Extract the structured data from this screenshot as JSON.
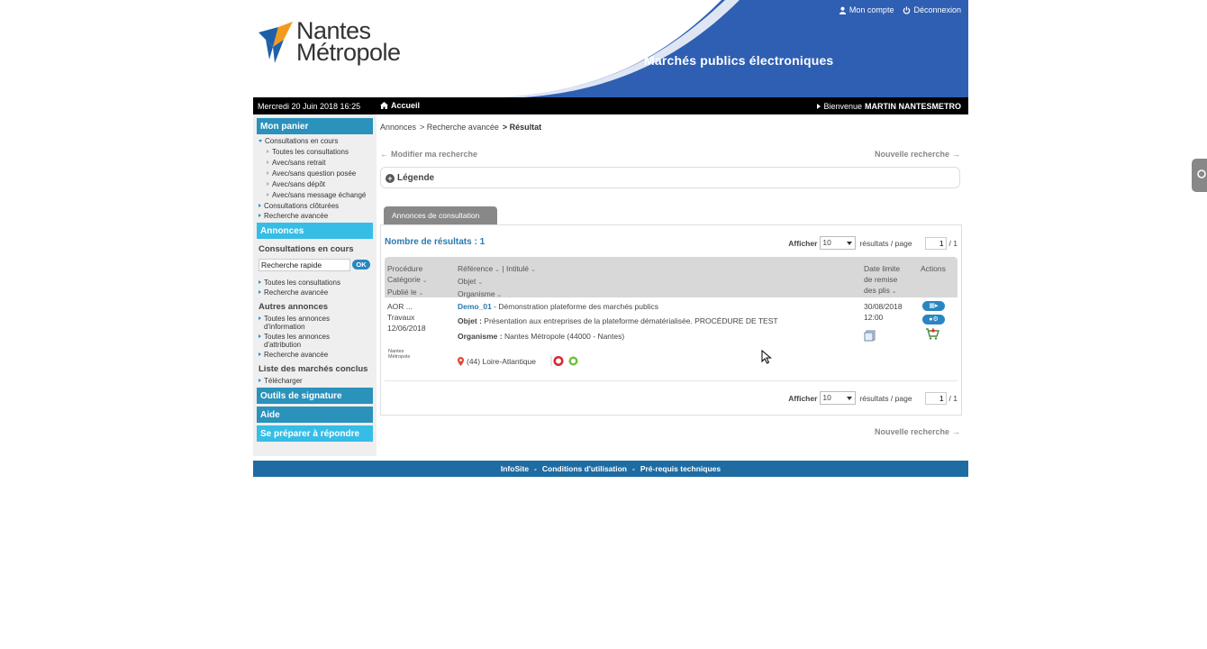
{
  "header": {
    "logo_line1": "Nantes",
    "logo_line2": "Métropole",
    "site_title": "Marchés publics électroniques",
    "account_link": "Mon compte",
    "logout_link": "Déconnexion",
    "colors": {
      "brand_blue": "#2f5fb3",
      "accent_blue": "#2a92bb",
      "light_blue": "#36bde6"
    }
  },
  "topbar": {
    "date": "Mercredi 20 Juin 2018 16:25",
    "home_label": "Accueil",
    "welcome_prefix": "Bienvenue",
    "welcome_user": "MARTIN NANTESMETRO"
  },
  "sidebar": {
    "panier_title": "Mon panier",
    "consultations_en_cours": "Consultations en cours",
    "panier_items": [
      "Toutes les consultations",
      "Avec/sans retrait",
      "Avec/sans question posée",
      "Avec/sans dépôt",
      "Avec/sans message échangé"
    ],
    "consultations_cloturees": "Consultations clôturées",
    "recherche_avancee": "Recherche avancée",
    "annonces_title": "Annonces",
    "annonces_section": "Consultations en cours",
    "quick_search_value": "Recherche rapide",
    "ok_label": "OK",
    "annonces_items": [
      "Toutes les consultations",
      "Recherche avancée"
    ],
    "autres_annonces": "Autres annonces",
    "autres_items": [
      "Toutes les annonces d'information",
      "Toutes les annonces d'attribution",
      "Recherche avancée"
    ],
    "marches_conclus": "Liste des marchés conclus",
    "telecharger": "Télécharger",
    "outils_signature": "Outils de signature",
    "aide": "Aide",
    "se_preparer": "Se préparer à répondre"
  },
  "main": {
    "breadcrumb": [
      "Annonces",
      "> Recherche avancée",
      "> Résultat"
    ],
    "modify_search": "Modifier ma recherche",
    "new_search": "Nouvelle recherche",
    "legend": "Légende",
    "tab_label": "Annonces de consultation",
    "results_count": "Nombre de résultats : 1",
    "pager": {
      "show_label": "Afficher",
      "per_page_value": "10",
      "per_page_suffix": "résultats / page",
      "page_value": "1",
      "page_total": "/ 1"
    },
    "table_headers": {
      "col1": [
        "Procédure",
        "Catégorie",
        "Publié le"
      ],
      "col2": [
        "Référence",
        "| Intitulé",
        "Objet",
        "Organisme"
      ],
      "col3": [
        "Date limite",
        "de remise",
        "des plis"
      ],
      "col4": "Actions"
    },
    "row": {
      "procedure": "AOR ...",
      "categorie": "Travaux",
      "publie_le": "12/06/2018",
      "org_logo_text": "Nantes Métropole",
      "reference": "Demo_01",
      "intitule": " - Démonstration plateforme des marchés publics",
      "objet_label": "Objet :",
      "objet": " Présentation aux entreprises de la plateforme dématérialisée. PROCÉDURE DE TEST",
      "organisme_label": "Organisme :",
      "organisme": " Nantes Métropole (44000 - Nantes)",
      "lieu": "(44) Loire-Atlantique",
      "date_limite": "30/08/2018",
      "heure_limite": "12:00"
    }
  },
  "footer": {
    "links": [
      "InfoSite",
      "Conditions d'utilisation",
      "Pré-requis techniques"
    ],
    "separator": "-"
  }
}
